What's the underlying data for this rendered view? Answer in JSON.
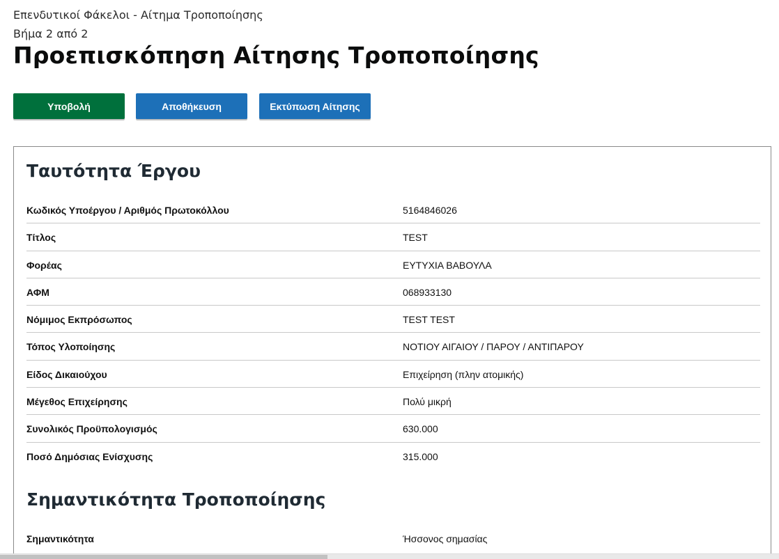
{
  "header": {
    "breadcrumb": "Επενδυτικοί Φάκελοι - Αίτημα Τροποποίησης",
    "step": "Βήμα 2 από 2",
    "title": "Προεπισκόπηση Αίτησης Τροποποίησης"
  },
  "actions": {
    "submit_label": "Υποβολή",
    "save_label": "Αποθήκευση",
    "print_label": "Εκτύπωση Αίτησης"
  },
  "colors": {
    "submit": "#00703c",
    "primary": "#1d70b8"
  },
  "project_identity": {
    "title": "Ταυτότητα Έργου",
    "rows": [
      {
        "key": "Κωδικός Υποέργου / Αριθμός Πρωτοκόλλου",
        "value": "5164846026"
      },
      {
        "key": "Τίτλος",
        "value": "TEST"
      },
      {
        "key": "Φορέας",
        "value": "ΕΥΤΥΧΙΑ ΒΑΒΟΥΛΑ"
      },
      {
        "key": "ΑΦΜ",
        "value": "068933130"
      },
      {
        "key": "Νόμιμος Εκπρόσωπος",
        "value": "TEST TEST"
      },
      {
        "key": "Τόπος Υλοποίησης",
        "value": "ΝΟΤΙΟΥ ΑΙΓΑΙΟΥ / ΠΑΡΟΥ / ΑΝΤΙΠΑΡΟΥ"
      },
      {
        "key": "Είδος Δικαιούχου",
        "value": "Επιχείρηση (πλην ατομικής)"
      },
      {
        "key": "Μέγεθος Επιχείρησης",
        "value": "Πολύ μικρή"
      },
      {
        "key": "Συνολικός Προϋπολογισμός",
        "value": "630.000"
      },
      {
        "key": "Ποσό Δημόσιας Ενίσχυσης",
        "value": "315.000"
      }
    ]
  },
  "modification_significance": {
    "title": "Σημαντικότητα Τροποποίησης",
    "rows": [
      {
        "key": "Σημαντικότητα",
        "value": "Ήσσονος σημασίας"
      }
    ]
  }
}
